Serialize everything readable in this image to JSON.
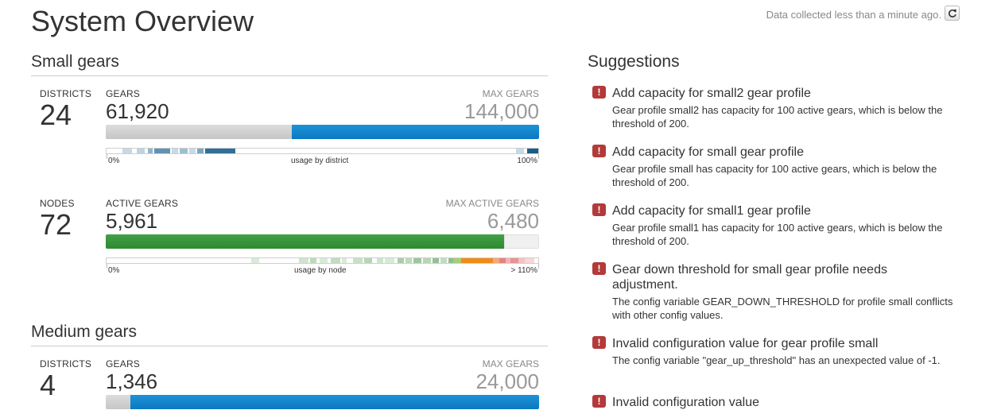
{
  "header": {
    "title": "System Overview",
    "collected_text": "Data collected less than a minute ago.",
    "refresh_icon": "refresh-icon"
  },
  "small_gears": {
    "title": "Small gears",
    "districts_label": "Districts",
    "districts_value": "24",
    "gears_label": "Gears",
    "gears_value": "61,920",
    "max_gears_label": "Max gears",
    "max_gears_value": "144,000",
    "gears_fraction": 0.43,
    "district_axis": {
      "left": "0%",
      "center": "usage by district",
      "right": "100%"
    },
    "nodes_label": "Nodes",
    "nodes_value": "72",
    "active_label": "Active gears",
    "active_value": "5,961",
    "max_active_label": "Max active gears",
    "max_active_value": "6,480",
    "active_fraction": 0.92,
    "node_axis": {
      "left": "0%",
      "center": "usage by node",
      "right": "> 110%"
    }
  },
  "medium_gears": {
    "title": "Medium gears",
    "districts_label": "Districts",
    "districts_value": "4",
    "gears_label": "Gears",
    "gears_value": "1,346",
    "max_gears_label": "Max gears",
    "max_gears_value": "24,000",
    "gears_fraction": 0.056
  },
  "suggestions": {
    "title": "Suggestions",
    "items": [
      {
        "title": "Add capacity for small2 gear profile",
        "body": "Gear profile small2 has capacity for 100 active gears, which is below the threshold of 200."
      },
      {
        "title": "Add capacity for small gear profile",
        "body": "Gear profile small has capacity for 100 active gears, which is below the threshold of 200."
      },
      {
        "title": "Add capacity for small1 gear profile",
        "body": "Gear profile small1 has capacity for 100 active gears, which is below the threshold of 200."
      },
      {
        "title": "Gear down threshold for small gear profile needs adjustment.",
        "body": "The config variable GEAR_DOWN_THRESHOLD for profile small conflicts with other config values."
      },
      {
        "title": "Invalid configuration value for gear profile small",
        "body": "The config variable \"gear_up_threshold\" has an unexpected value of -1."
      },
      {
        "title": "Invalid configuration value",
        "body": ""
      }
    ],
    "icon_glyph": "!"
  },
  "colors": {
    "blue": "#0a78c2",
    "green": "#2d8a31",
    "alert": "#b33a3a"
  }
}
